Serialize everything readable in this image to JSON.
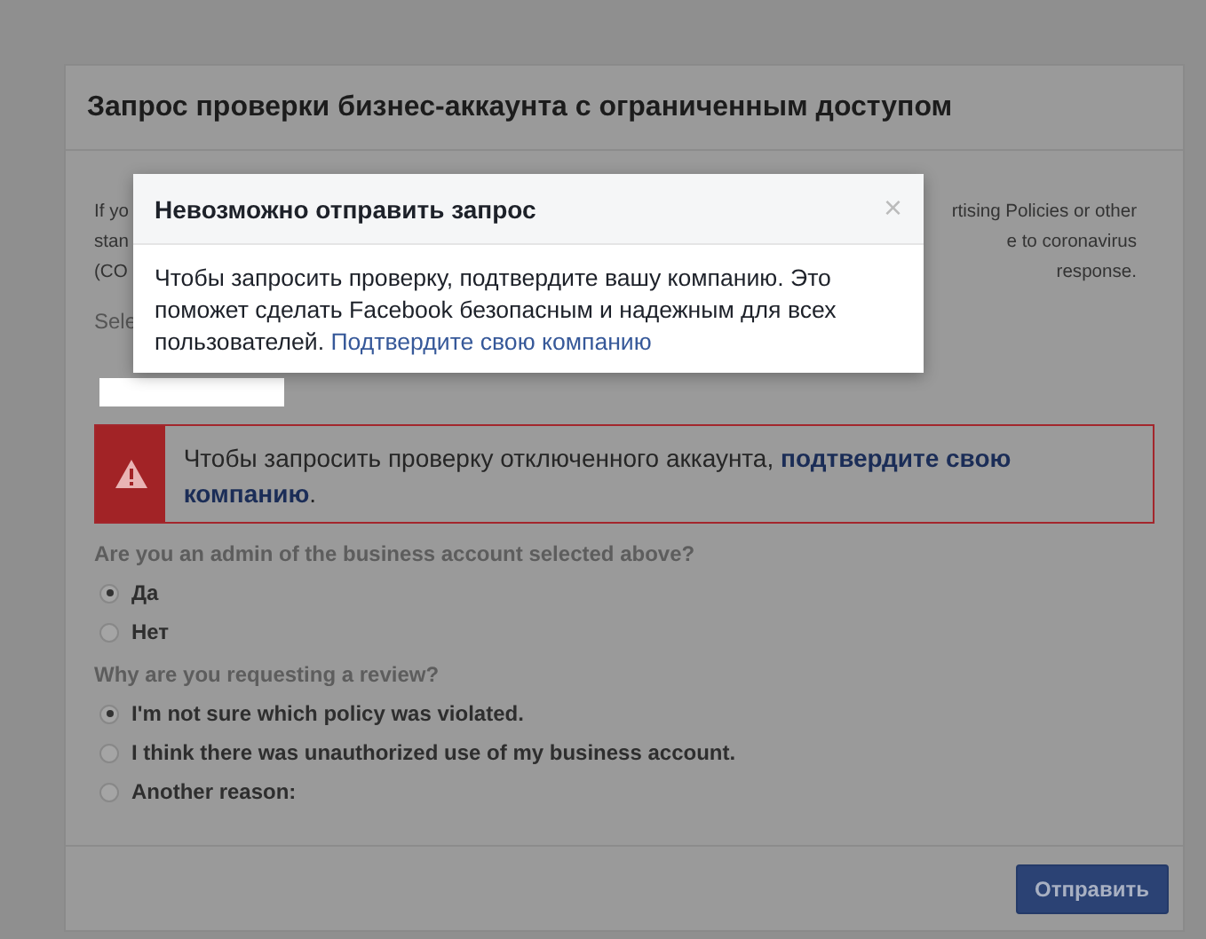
{
  "card": {
    "title": "Запрос проверки бизнес-аккаунта с ограниченным доступом",
    "intro_lines": [
      {
        "left": "If yo",
        "right": "rtising Policies or other"
      },
      {
        "left": "stan",
        "right": "e to coronavirus"
      },
      {
        "left": "(CO",
        "right": "response."
      }
    ],
    "select_label": "Sele",
    "alert": {
      "text": "Чтобы запросить проверку отключенного аккаунта, **подтвердите свою компанию**."
    },
    "questions": [
      {
        "label": "Are you an admin of the business account selected above?",
        "options": [
          {
            "label": "Да",
            "selected": true
          },
          {
            "label": "Нет",
            "selected": false
          }
        ]
      },
      {
        "label": "Why are you requesting a review?",
        "options": [
          {
            "label": "I'm not sure which policy was violated.",
            "selected": true
          },
          {
            "label": "I think there was unauthorized use of my business account.",
            "selected": false
          },
          {
            "label": "Another reason:",
            "selected": false
          }
        ]
      }
    ],
    "submit_button": "Отправить"
  },
  "dialog": {
    "title": "Невозможно отправить запрос",
    "close": "×",
    "text": "Чтобы запросить проверку, подтвердите вашу компанию. Это поможет сделать Facebook безопасным и надежным для всех пользователей.",
    "link": "Подтвердите свою компанию"
  }
}
